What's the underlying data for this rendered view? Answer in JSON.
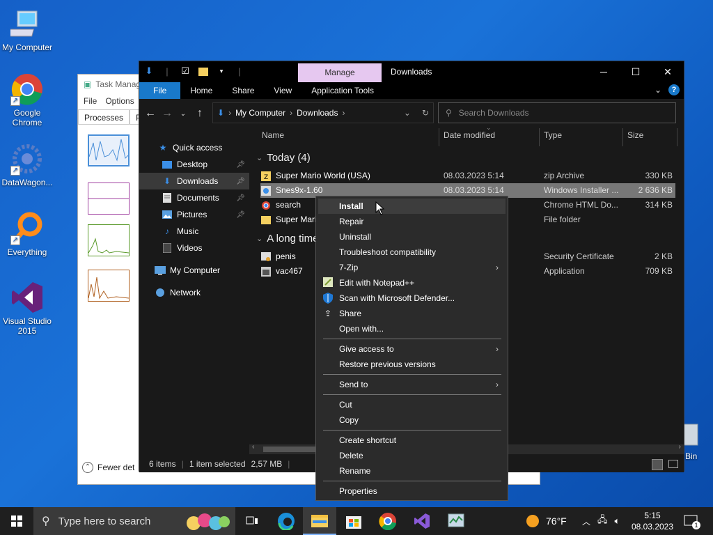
{
  "desktop": {
    "icons": [
      {
        "label": "My Computer"
      },
      {
        "label": "Google Chrome"
      },
      {
        "label": "DataWagon..."
      },
      {
        "label": "Everything"
      },
      {
        "label": "Visual Studio 2015"
      }
    ],
    "recycle_bin_label": "e Bin"
  },
  "task_manager": {
    "title": "Task Manag",
    "menu": [
      "File",
      "Options"
    ],
    "tabs": [
      "Processes",
      "Pe"
    ],
    "footer": "Fewer det"
  },
  "explorer": {
    "manage_tab": "Manage",
    "title": "Downloads",
    "ribbon_tabs": [
      "File",
      "Home",
      "Share",
      "View",
      "Application Tools"
    ],
    "address": [
      "My Computer",
      "Downloads"
    ],
    "search_placeholder": "Search Downloads",
    "nav": [
      {
        "label": "Quick access"
      },
      {
        "label": "Desktop"
      },
      {
        "label": "Downloads"
      },
      {
        "label": "Documents"
      },
      {
        "label": "Pictures"
      },
      {
        "label": "Music"
      },
      {
        "label": "Videos"
      },
      {
        "label": "My Computer"
      },
      {
        "label": "Network"
      }
    ],
    "columns": [
      "Name",
      "Date modified",
      "Type",
      "Size"
    ],
    "groups": [
      "Today (4)",
      "A long time"
    ],
    "files": [
      {
        "name": "Super Mario World (USA)",
        "date": "08.03.2023 5:14",
        "type": "zip Archive",
        "size": "330 KB"
      },
      {
        "name": "Snes9x-1.60",
        "date": "08.03.2023 5:14",
        "type": "Windows Installer ...",
        "size": "2 636 KB"
      },
      {
        "name": "search",
        "date": "",
        "type": "Chrome HTML Do...",
        "size": "314 KB"
      },
      {
        "name": "Super Mari",
        "date": "",
        "type": "File folder",
        "size": ""
      },
      {
        "name": "penis",
        "date": "",
        "type": "Security Certificate",
        "size": "2 KB"
      },
      {
        "name": "vac467",
        "date": "",
        "type": "Application",
        "size": "709 KB"
      }
    ],
    "status": {
      "items": "6 items",
      "selected": "1 item selected",
      "size": "2,57 MB"
    }
  },
  "context_menu": {
    "items": [
      "Install",
      "Repair",
      "Uninstall",
      "Troubleshoot compatibility",
      "7-Zip",
      "Edit with Notepad++",
      "Scan with Microsoft Defender...",
      "Share",
      "Open with...",
      "Give access to",
      "Restore previous versions",
      "Send to",
      "Cut",
      "Copy",
      "Create shortcut",
      "Delete",
      "Rename",
      "Properties"
    ]
  },
  "taskbar": {
    "search_placeholder": "Type here to search",
    "weather": "76°F",
    "time": "5:15",
    "date": "08.03.2023",
    "notification_count": "1"
  }
}
